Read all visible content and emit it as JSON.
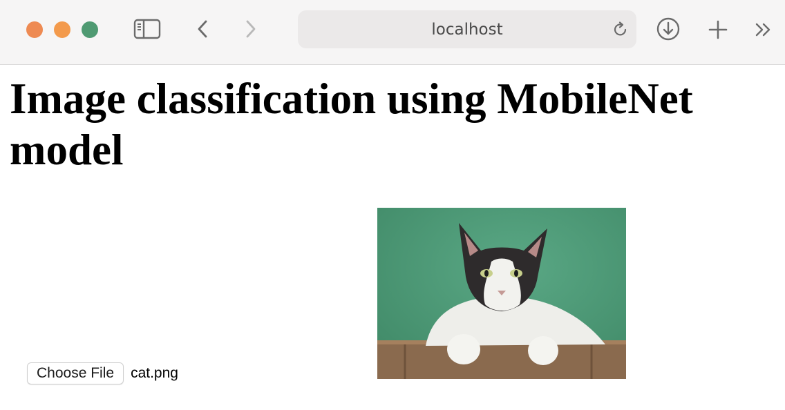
{
  "browser": {
    "address": "localhost",
    "colors": {
      "close": "#ee8a52",
      "minimize": "#f39a4c",
      "zoom": "#4f9a72",
      "icon": "#6b6b6b"
    },
    "icons": [
      "sidebar-icon",
      "back-chevron-icon",
      "forward-chevron-icon",
      "reload-icon",
      "download-icon",
      "plus-icon",
      "double-chevron-icon"
    ]
  },
  "page": {
    "title": "Image classification using MobileNet model",
    "file_input": {
      "button_label": "Choose File",
      "file_name": "cat.png"
    },
    "image": {
      "subject": "cat-photo",
      "colors": {
        "background": "#4f9a7c",
        "box": "#8a6a4e"
      }
    }
  }
}
